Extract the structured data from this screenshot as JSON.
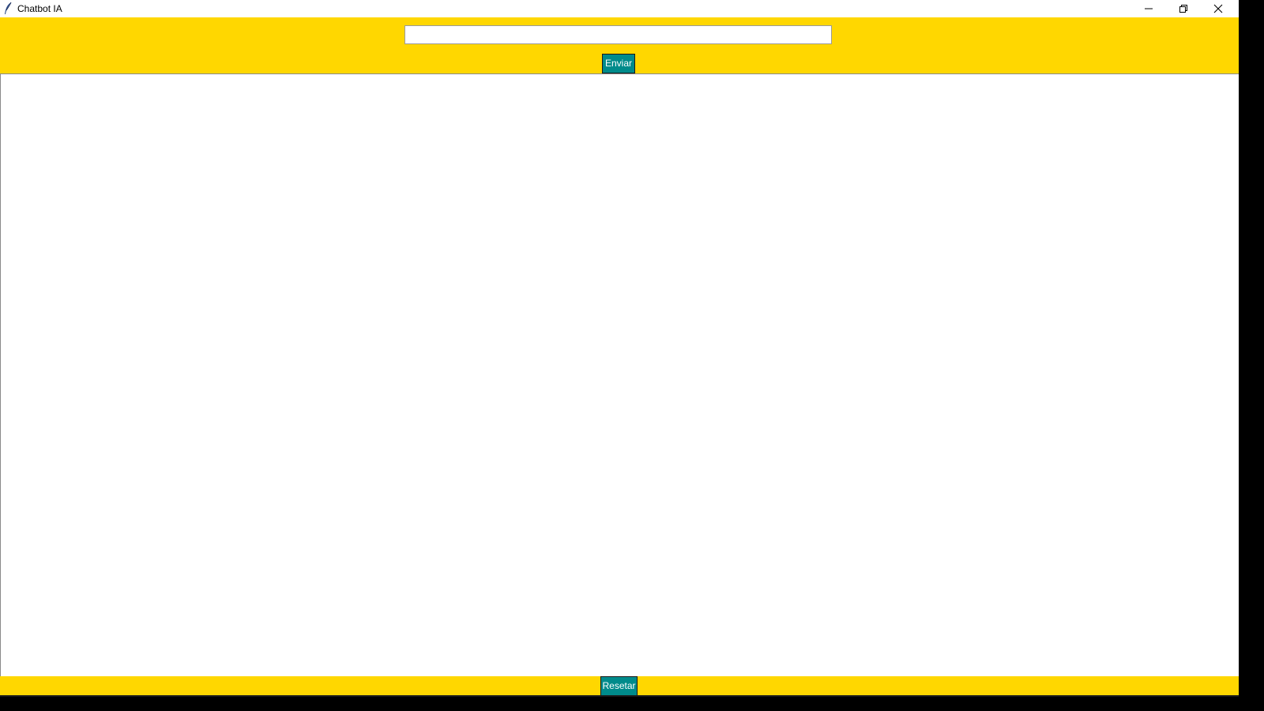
{
  "window": {
    "title": "Chatbot IA",
    "controls": {
      "minimize": "minimize-icon",
      "maximize": "restore-icon",
      "close": "close-icon"
    }
  },
  "input": {
    "value": "",
    "placeholder": ""
  },
  "buttons": {
    "send_label": "Enviar",
    "reset_label": "Resetar"
  },
  "colors": {
    "panel_background": "#FFD700",
    "button_background": "#008B8B",
    "button_text": "#FFFFFF",
    "chat_background": "#FFFFFF"
  }
}
